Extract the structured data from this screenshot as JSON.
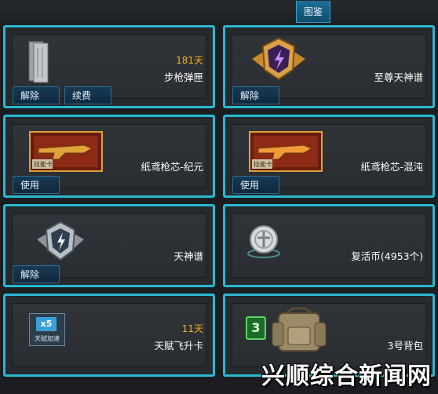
{
  "header": {
    "tab_label": "图鉴"
  },
  "cards": [
    {
      "name": "步枪弹匣",
      "days": "181天",
      "buttons": [
        "解除",
        "续费"
      ],
      "icon": "magazine-icon"
    },
    {
      "name": "至尊天神谱",
      "buttons": [
        "解除"
      ],
      "icon": "supreme-emblem-icon"
    },
    {
      "name": "纸鸢枪芯-纪元",
      "buttons": [
        "使用"
      ],
      "icon": "gun-core-card-icon",
      "card_badge": "技能卡"
    },
    {
      "name": "纸鸢枪芯-混沌",
      "buttons": [
        "使用"
      ],
      "icon": "gun-core-card-icon",
      "card_badge": "技能卡"
    },
    {
      "name": "天神谱",
      "buttons": [
        "解除"
      ],
      "icon": "emblem-icon"
    },
    {
      "name": "复活币(4953个)",
      "buttons": [],
      "icon": "revive-coin-icon"
    },
    {
      "name": "天赋飞升卡",
      "days": "11天",
      "buttons": [],
      "icon": "talent-card-icon",
      "badge": "x5",
      "badge_caption": "天赋加速"
    },
    {
      "name": "3号背包",
      "buttons": [],
      "icon": "backpack-icon",
      "badge": "3"
    }
  ],
  "watermark": "兴顺综合新闻网",
  "colors": {
    "accent": "#2ab8d1",
    "days": "#f2b21a",
    "button": "#183a55"
  }
}
